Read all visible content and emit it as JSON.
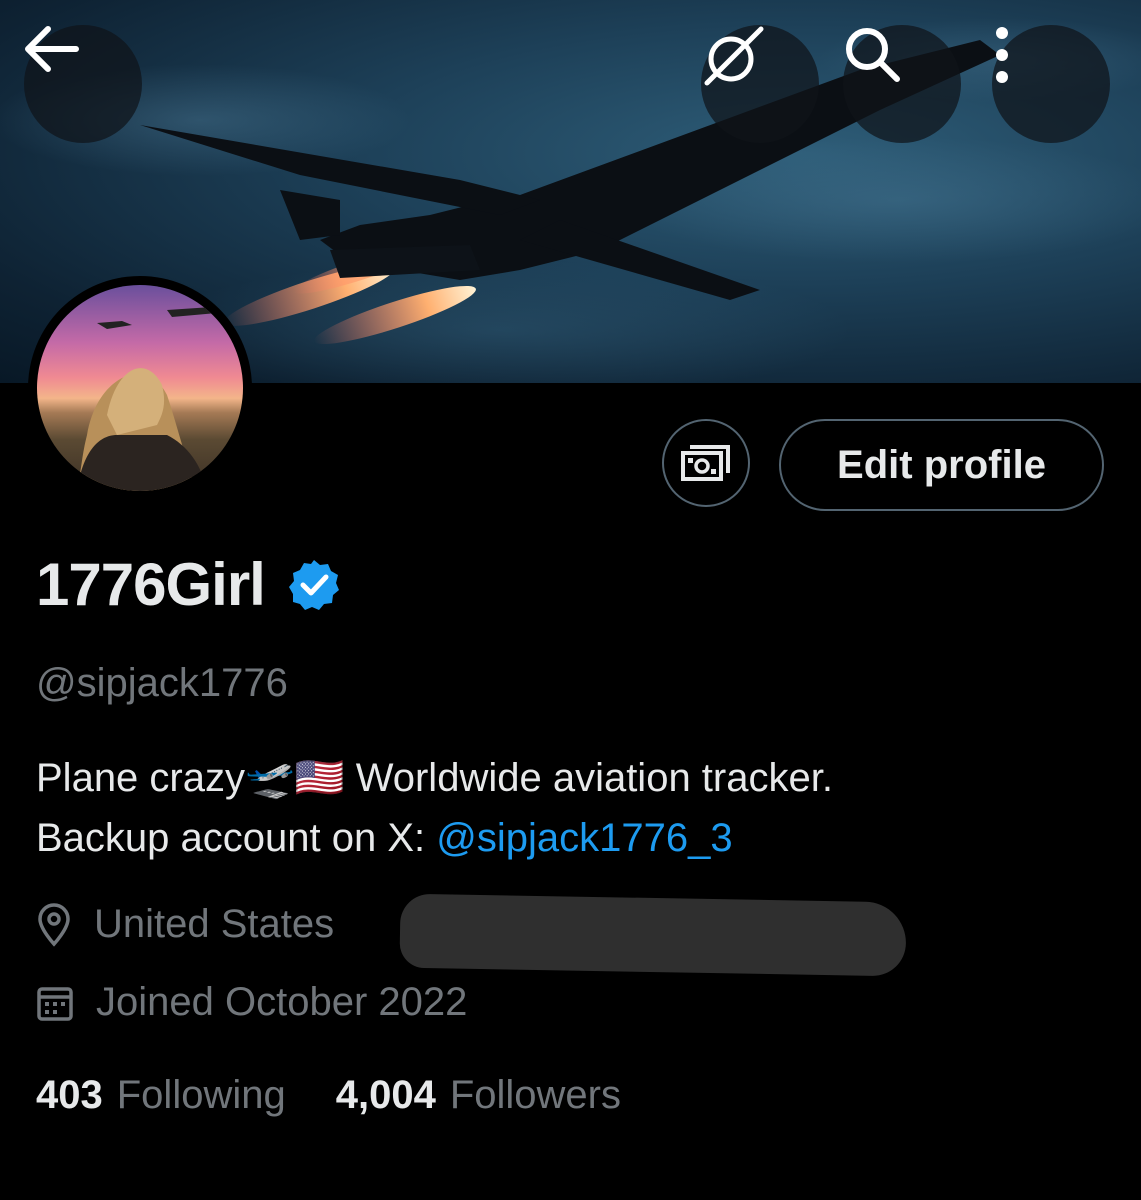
{
  "banner": {
    "back_icon": "arrow-left-icon",
    "grok_icon": "grok-icon",
    "search_icon": "search-icon",
    "more_icon": "more-vertical-icon"
  },
  "actions": {
    "wallet_icon": "money-icon",
    "edit_profile": "Edit profile"
  },
  "profile": {
    "display_name": "1776Girl",
    "verified_color": "#1d9bf0",
    "handle": "@sipjack1776",
    "bio_line1": "Plane crazy🛫🇺🇸 Worldwide aviation tracker.",
    "bio_line2_prefix": "Backup account on X: ",
    "bio_mention": "@sipjack1776_3",
    "location": "United States",
    "joined": "Joined October 2022"
  },
  "stats": {
    "following_count": "403",
    "following_label": "Following",
    "followers_count": "4,004",
    "followers_label": "Followers"
  },
  "colors": {
    "accent": "#1d9bf0",
    "muted": "#71767b",
    "text": "#e7e9ea"
  }
}
